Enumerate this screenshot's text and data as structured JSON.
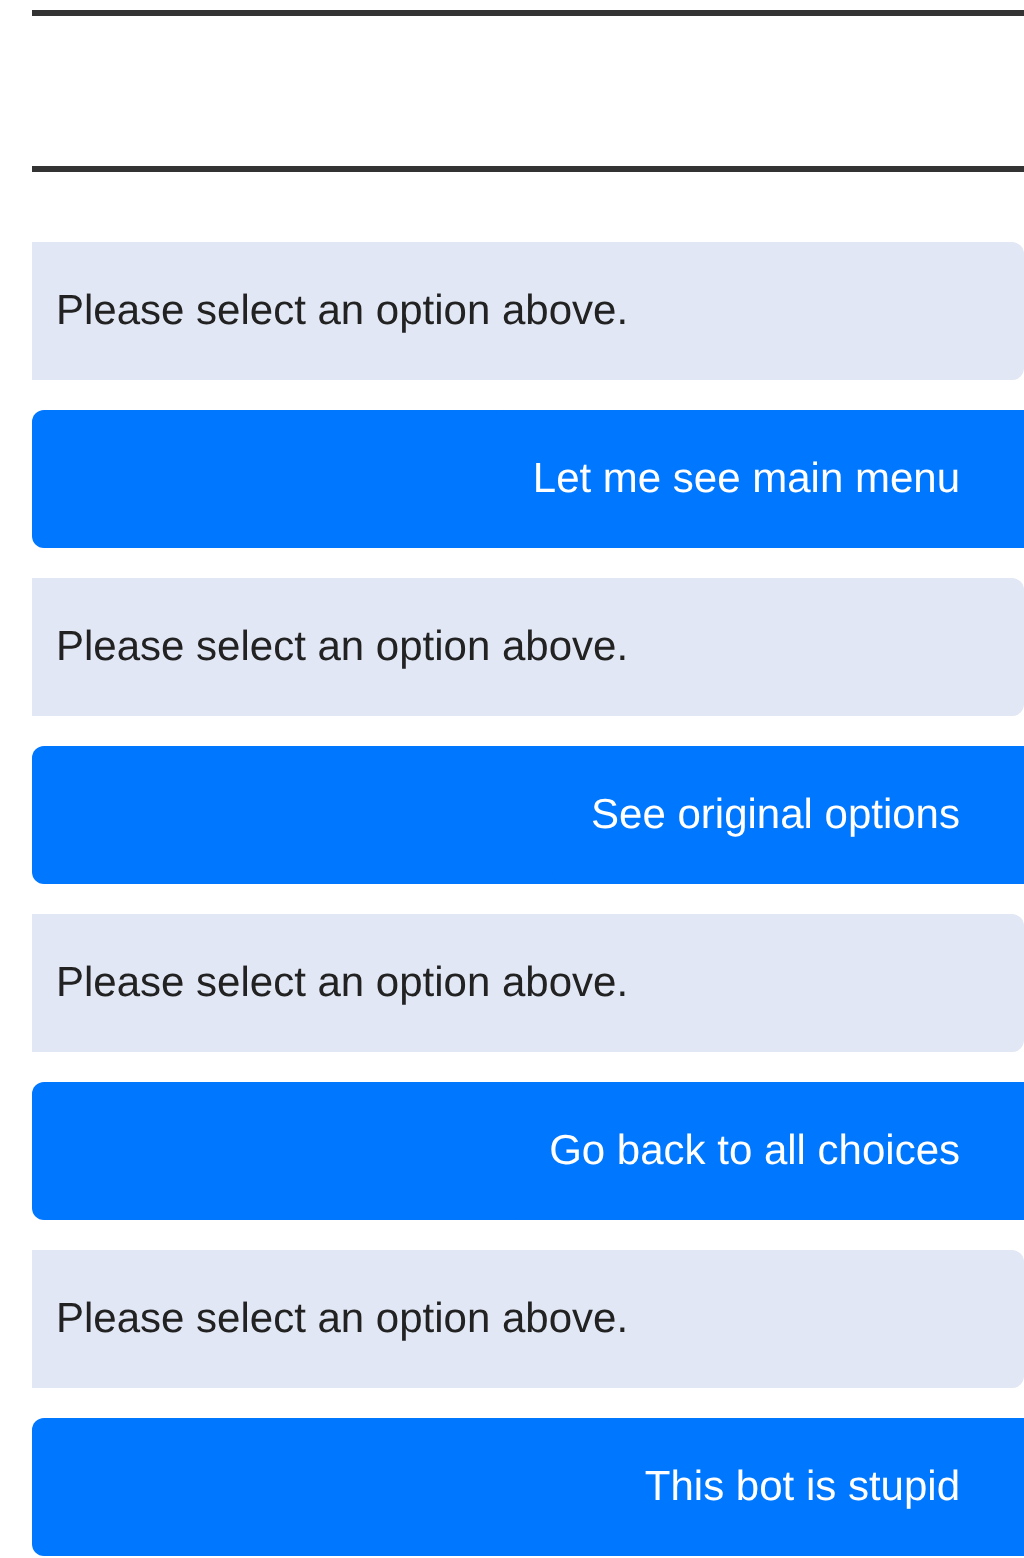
{
  "messages": [
    {
      "kind": "bot",
      "text": "Please select an option above."
    },
    {
      "kind": "user",
      "text": "Let me see main menu"
    },
    {
      "kind": "bot",
      "text": "Please select an option above."
    },
    {
      "kind": "user",
      "text": "See original options"
    },
    {
      "kind": "bot",
      "text": "Please select an option above."
    },
    {
      "kind": "user",
      "text": "Go back to all choices"
    },
    {
      "kind": "bot",
      "text": "Please select an option above."
    },
    {
      "kind": "user",
      "text": "This bot is stupid"
    }
  ]
}
